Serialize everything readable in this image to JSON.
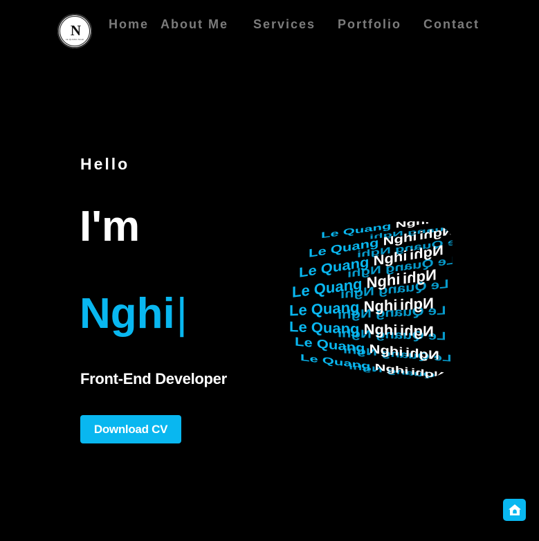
{
  "logo": {
    "mark": "N",
    "subtitle": "LE QUANG NGHI"
  },
  "nav": {
    "items": [
      {
        "label": "Home"
      },
      {
        "label": "About Me"
      },
      {
        "label": "Services"
      },
      {
        "label": "Portfolio"
      },
      {
        "label": "Contact"
      }
    ]
  },
  "hero": {
    "greeting": "Hello",
    "intro": "I'm",
    "name": "Nghi",
    "cursor": "|",
    "role": "Front-End Developer",
    "cv_button": "Download CV"
  },
  "cylinder": {
    "front_text": "Le Quang Nghi",
    "back_text": "Le Quang Nghi",
    "front_color": "#09b7f0",
    "accent_color": "#ffffff"
  },
  "fab": {
    "icon": "home-icon"
  },
  "colors": {
    "background": "#000000",
    "accent": "#09b7f0",
    "text": "#ffffff",
    "nav": "#7c7c7c"
  }
}
